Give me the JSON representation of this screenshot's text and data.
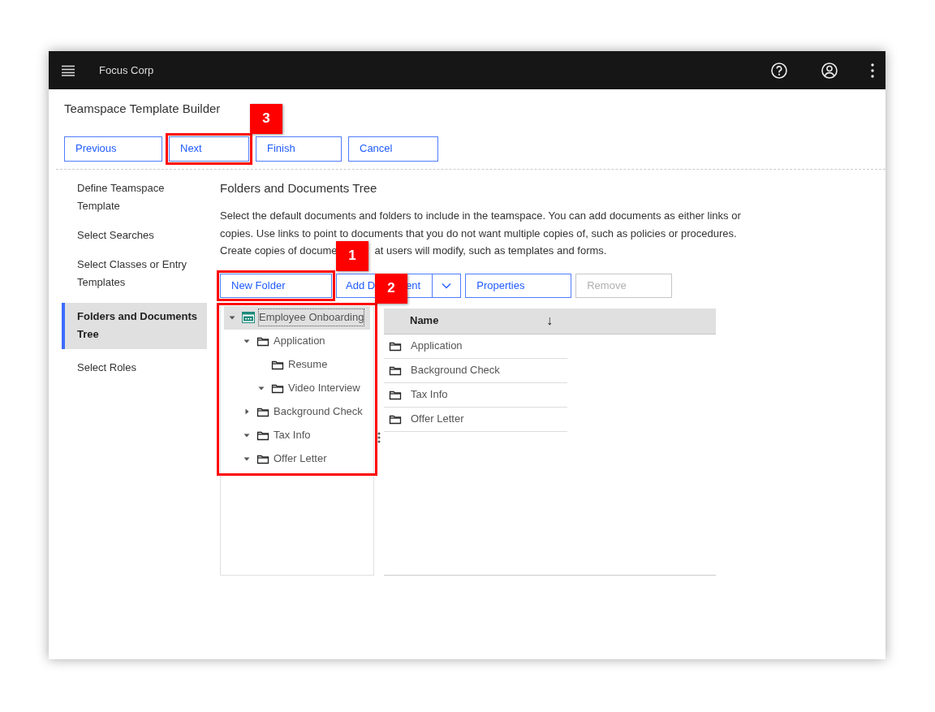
{
  "header": {
    "app_name": "Focus Corp"
  },
  "page": {
    "title": "Teamspace Template Builder"
  },
  "wizard_buttons": [
    {
      "label": "Previous"
    },
    {
      "label": "Next",
      "callout": "3"
    },
    {
      "label": "Finish"
    },
    {
      "label": "Cancel"
    }
  ],
  "steps": [
    {
      "label": "Define Teamspace Template",
      "selected": false
    },
    {
      "label": "Select Searches",
      "selected": false
    },
    {
      "label": "Select Classes or Entry Templates",
      "selected": false
    },
    {
      "label": "Folders and Documents Tree",
      "selected": true
    },
    {
      "label": "Select Roles",
      "selected": false
    }
  ],
  "section": {
    "heading": "Folders and Documents Tree",
    "description_lines": [
      [
        "Select the default documents and folders to include in the teamspace. You can add documents as either links or"
      ],
      [
        "copies. Use links to point to documents that you do not want multiple copies of, such as policies or procedures."
      ],
      [
        "Create copies of docume",
        "at users will modify, such as templates and forms."
      ]
    ]
  },
  "toolbar": [
    {
      "kind": "button",
      "label": [
        "New Folder"
      ],
      "disabled": false,
      "callout": "1"
    },
    {
      "kind": "split",
      "label": [
        "Add D",
        "ent"
      ],
      "disabled": false
    },
    {
      "kind": "button",
      "label": [
        "Properties"
      ],
      "disabled": false
    },
    {
      "kind": "button",
      "label": [
        "Remove"
      ],
      "disabled": true
    }
  ],
  "tree": {
    "callout": "2",
    "nodes": [
      {
        "label": "Employee Onboarding",
        "kind": "teamspace",
        "expanded": true,
        "selected": true,
        "children": [
          {
            "label": "Application",
            "kind": "folder",
            "expanded": true,
            "selected": false,
            "children": [
              {
                "label": "Resume",
                "kind": "folder",
                "selected": false
              },
              {
                "label": "Video Interview",
                "kind": "folder",
                "expanded": true,
                "selected": false
              }
            ]
          },
          {
            "label": "Background Check",
            "kind": "folder",
            "expanded": false,
            "selected": false
          },
          {
            "label": "Tax Info",
            "kind": "folder",
            "expanded": true,
            "selected": false
          },
          {
            "label": "Offer Letter",
            "kind": "folder",
            "expanded": true,
            "selected": false
          }
        ]
      }
    ]
  },
  "table": {
    "columns": [
      {
        "label": "Name",
        "sort_indicator": "↓"
      }
    ],
    "rows": [
      {
        "kind": "folder",
        "name": "Application"
      },
      {
        "kind": "folder",
        "name": "Background Check"
      },
      {
        "kind": "folder",
        "name": "Tax Info"
      },
      {
        "kind": "folder",
        "name": "Offer Letter"
      }
    ]
  }
}
